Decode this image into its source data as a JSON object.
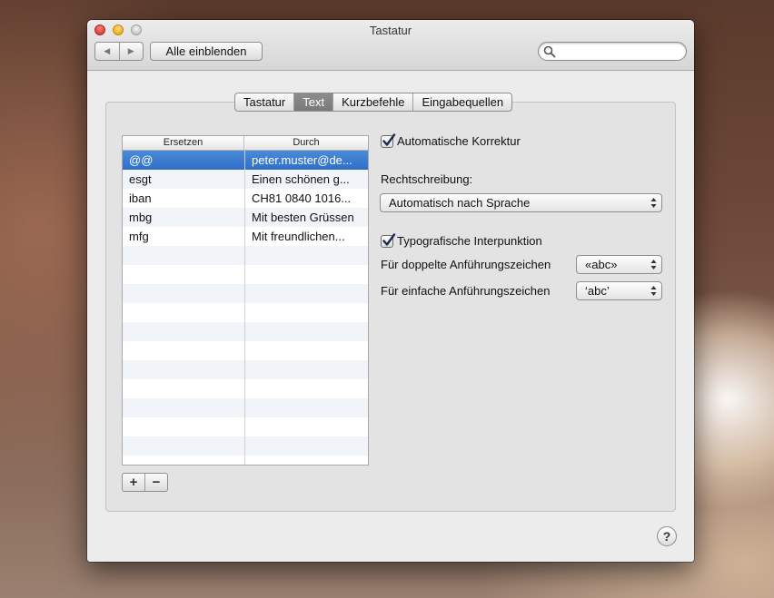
{
  "window": {
    "title": "Tastatur",
    "show_all_label": "Alle einblenden",
    "back_glyph": "◀",
    "forward_glyph": "▶",
    "search_placeholder": ""
  },
  "tabs": [
    {
      "label": "Tastatur",
      "active": false
    },
    {
      "label": "Text",
      "active": true
    },
    {
      "label": "Kurzbefehle",
      "active": false
    },
    {
      "label": "Eingabequellen",
      "active": false
    }
  ],
  "table": {
    "columns": [
      "Ersetzen",
      "Durch"
    ],
    "rows": [
      {
        "replace": "@@",
        "with": "peter.muster@de...",
        "selected": true
      },
      {
        "replace": "esgt",
        "with": "Einen schönen g..."
      },
      {
        "replace": "iban",
        "with": "CH81 0840 1016..."
      },
      {
        "replace": "mbg",
        "with": "Mit besten Grüssen"
      },
      {
        "replace": "mfg",
        "with": "Mit freundlichen..."
      }
    ]
  },
  "buttons": {
    "add": "+",
    "remove": "−",
    "help": "?"
  },
  "options": {
    "autocorrect_label": "Automatische Korrektur",
    "autocorrect_checked": true,
    "spelling_label": "Rechtschreibung:",
    "spelling_value": "Automatisch nach Sprache",
    "typo_label": "Typografische Interpunktion",
    "typo_checked": true,
    "double_quotes_label": "Für doppelte Anführungszeichen",
    "double_quotes_value": "«abc»",
    "single_quotes_label": "Für einfache Anführungszeichen",
    "single_quotes_value": "‘abc’"
  },
  "colors": {
    "selection": "#3a7bd5",
    "active_tab": "#808080"
  }
}
